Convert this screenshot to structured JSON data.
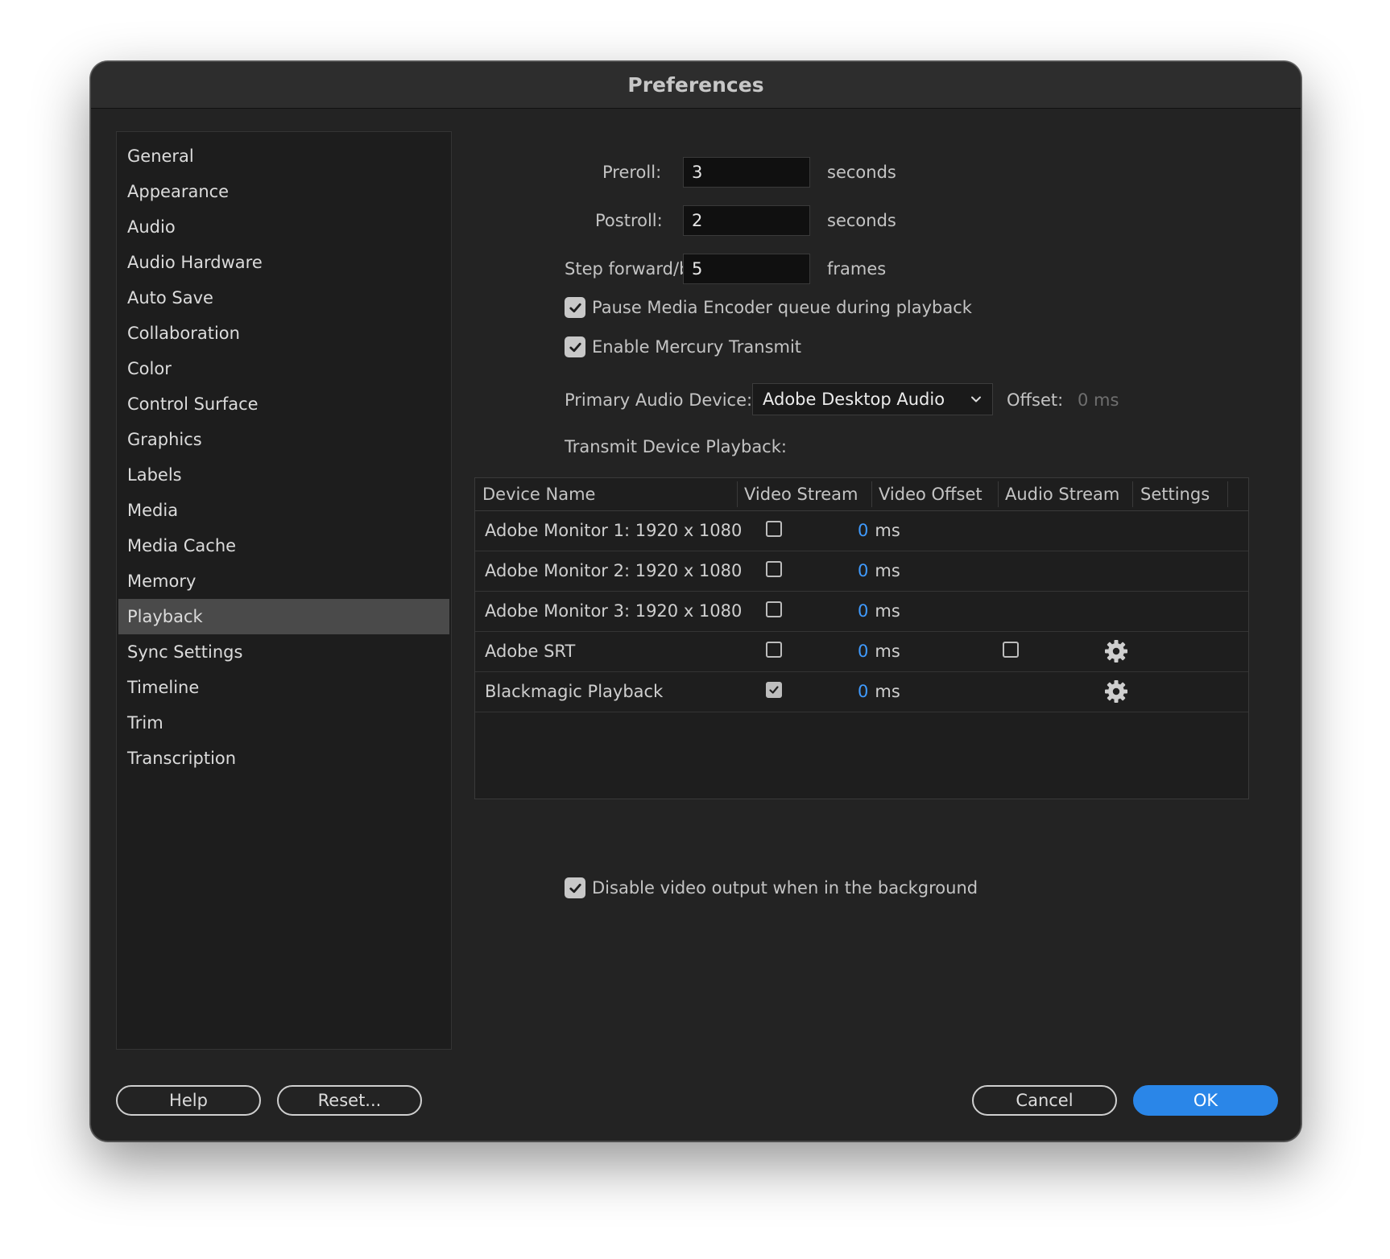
{
  "window": {
    "title": "Preferences"
  },
  "sidebar": {
    "items": [
      {
        "label": "General"
      },
      {
        "label": "Appearance"
      },
      {
        "label": "Audio"
      },
      {
        "label": "Audio Hardware"
      },
      {
        "label": "Auto Save"
      },
      {
        "label": "Collaboration"
      },
      {
        "label": "Color"
      },
      {
        "label": "Control Surface"
      },
      {
        "label": "Graphics"
      },
      {
        "label": "Labels"
      },
      {
        "label": "Media"
      },
      {
        "label": "Media Cache"
      },
      {
        "label": "Memory"
      },
      {
        "label": "Playback"
      },
      {
        "label": "Sync Settings"
      },
      {
        "label": "Timeline"
      },
      {
        "label": "Trim"
      },
      {
        "label": "Transcription"
      }
    ],
    "selected": "Playback"
  },
  "playback": {
    "preroll": {
      "label": "Preroll:",
      "value": "3",
      "unit": "seconds"
    },
    "postroll": {
      "label": "Postroll:",
      "value": "2",
      "unit": "seconds"
    },
    "step": {
      "label": "Step forward/back many:",
      "value": "5",
      "unit": "frames"
    },
    "pause_encoder": {
      "label": "Pause Media Encoder queue during playback",
      "checked": true
    },
    "mercury_transmit": {
      "label": "Enable Mercury Transmit",
      "checked": true
    },
    "audio_device": {
      "label": "Primary Audio Device:",
      "value": "Adobe Desktop Audio",
      "offset_label": "Offset:",
      "offset_value": "0 ms"
    },
    "transmit_label": "Transmit Device Playback:",
    "disable_bg": {
      "label": "Disable video output when in the background",
      "checked": true
    }
  },
  "table": {
    "headers": [
      "Device Name",
      "Video Stream",
      "Video Offset",
      "Audio Stream",
      "Settings"
    ],
    "rows": [
      {
        "name": "Adobe Monitor 1: 1920 x 1080",
        "video_stream": false,
        "offset_value": "0",
        "offset_unit": "ms"
      },
      {
        "name": "Adobe Monitor 2: 1920 x 1080",
        "video_stream": false,
        "offset_value": "0",
        "offset_unit": "ms"
      },
      {
        "name": "Adobe Monitor 3: 1920 x 1080",
        "video_stream": false,
        "offset_value": "0",
        "offset_unit": "ms"
      },
      {
        "name": "Adobe SRT",
        "video_stream": false,
        "offset_value": "0",
        "offset_unit": "ms",
        "audio_stream": false,
        "settings_icon": "gear-icon"
      },
      {
        "name": "Blackmagic Playback",
        "video_stream": true,
        "offset_value": "0",
        "offset_unit": "ms",
        "settings_icon": "gear-icon"
      }
    ]
  },
  "buttons": {
    "help": "Help",
    "reset": "Reset...",
    "cancel": "Cancel",
    "ok": "OK"
  },
  "colors": {
    "accent": "#2a86e8",
    "offset_value": "#3f9bff",
    "background": "#232323"
  }
}
